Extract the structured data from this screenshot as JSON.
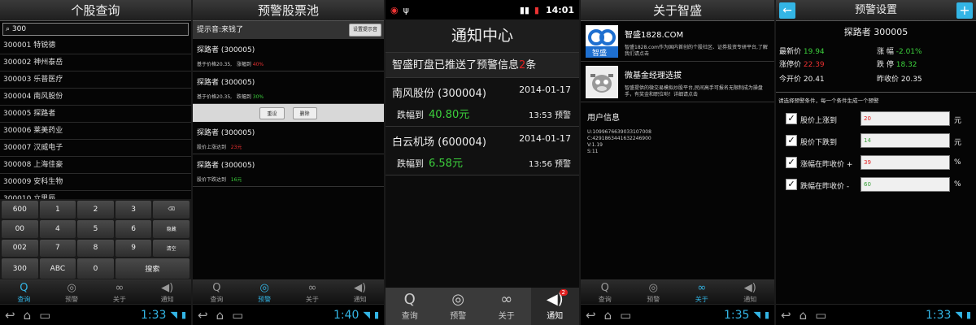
{
  "screen1": {
    "title": "个股查询",
    "search_value": "300",
    "stocks": [
      "300001 特锐德",
      "300002 神州泰岳",
      "300003 乐普医疗",
      "300004 南风股份",
      "300005 探路者",
      "300006 莱美药业",
      "300007 汉威电子",
      "300008 上海佳豪",
      "300009 安科生物",
      "300010 立思辰"
    ],
    "keys": [
      "600",
      "1",
      "2",
      "3",
      "⌫",
      "00",
      "4",
      "5",
      "6",
      "隐藏",
      "002",
      "7",
      "8",
      "9",
      "清空",
      "300",
      "ABC",
      "0",
      "搜索"
    ],
    "tabs": [
      {
        "label": "查询",
        "icon": "Q"
      },
      {
        "label": "预警",
        "icon": "◎"
      },
      {
        "label": "关于",
        "icon": "∞"
      },
      {
        "label": "通知",
        "icon": "◀)"
      }
    ],
    "clock": "1:33"
  },
  "screen2": {
    "title": "预警股票池",
    "hint_label": "提示音:来钱了",
    "set_button": "设置提示音",
    "items": [
      {
        "name": "探路者 (300005)",
        "detail": "基于价格20.35,",
        "change_label": "涨幅到",
        "change_value": "40%",
        "color": "red"
      },
      {
        "name": "探路者 (300005)",
        "detail": "基于价格20.35,",
        "change_label": "跌幅到",
        "change_value": "30%",
        "color": "green"
      }
    ],
    "reset_button": "重设",
    "delete_button": "删除",
    "items2": [
      {
        "name": "探路者 (300005)",
        "detail": "股价上涨达到",
        "value": "23元",
        "color": "red"
      },
      {
        "name": "探路者 (300005)",
        "detail": "股价下跌达到",
        "value": "16元",
        "color": "green"
      }
    ],
    "tabs": [
      {
        "label": "查询",
        "icon": "Q"
      },
      {
        "label": "预警",
        "icon": "◎"
      },
      {
        "label": "关于",
        "icon": "∞"
      },
      {
        "label": "通知",
        "icon": "◀)"
      }
    ],
    "clock": "1:40"
  },
  "screen3": {
    "status_time": "14:01",
    "title": "通知中心",
    "subtitle_pre": "智盛盯盘已推送了预警信息",
    "subtitle_num": "2",
    "subtitle_post": "条",
    "notices": [
      {
        "name": "南风股份 (300004)",
        "date": "2014-01-17",
        "label": "跌幅到",
        "value": "40.80元",
        "time": "13:53 预警"
      },
      {
        "name": "白云机场 (600004)",
        "date": "2014-01-17",
        "label": "跌幅到",
        "value": "6.58元",
        "time": "13:56 预警"
      }
    ],
    "tabs": [
      {
        "label": "查询",
        "icon": "Q"
      },
      {
        "label": "预警",
        "icon": "◎"
      },
      {
        "label": "关于",
        "icon": "∞"
      },
      {
        "label": "通知",
        "icon": "◀)"
      }
    ],
    "badge": "2"
  },
  "screen4": {
    "title": "关于智盛",
    "items": [
      {
        "title": "智盛1828.COM",
        "desc": "智盛1828.com作为国内首创的个股社区、证券投资专研平台,了解我们请点击",
        "logo_text": "智盛"
      },
      {
        "title": "微基金经理选拔",
        "desc": "智盛提供的微交易模拟炒股平台,民间高手可报名无限制成为操盘手，有奖金和职位哟！详细请点击",
        "logo_text": ""
      }
    ],
    "user_info_title": "用户信息",
    "user_info_lines": [
      "U:1099676639033107008",
      "C:4291863441632246900",
      "V:1.19",
      "S:11"
    ],
    "tabs": [
      {
        "label": "查询",
        "icon": "Q"
      },
      {
        "label": "预警",
        "icon": "◎"
      },
      {
        "label": "关于",
        "icon": "∞"
      },
      {
        "label": "通知",
        "icon": "◀)"
      }
    ],
    "clock": "1:35"
  },
  "screen5": {
    "title": "预警设置",
    "back_icon": "←",
    "add_icon": "+",
    "stock_name": "探路者 300005",
    "fields": {
      "latest_label": "最新价",
      "latest_value": "19.94",
      "change_label": "涨 幅",
      "change_value": "-2.01%",
      "limitup_label": "涨停价",
      "limitup_value": "22.39",
      "limitdown_label": "跌 停",
      "limitdown_value": "18.32",
      "open_label": "今开价",
      "open_value": "20.41",
      "prevclose_label": "昨收价",
      "prevclose_value": "20.35"
    },
    "condition_hint": "请选择预警条件，每一个条件生成一个预警",
    "conditions": [
      {
        "label": "股价上涨到",
        "value": "20",
        "unit": "元",
        "color": "#e02020"
      },
      {
        "label": "股价下跌到",
        "value": "14",
        "unit": "元",
        "color": "#3aa03a"
      },
      {
        "label": "涨幅在昨收价 +",
        "value": "39",
        "unit": "%",
        "color": "#e02020"
      },
      {
        "label": "跌幅在昨收价 -",
        "value": "60",
        "unit": "%",
        "color": "#3aa03a"
      }
    ],
    "clock": "1:33"
  },
  "colors": {
    "accent": "#33b5e5",
    "up": "#e83030",
    "down": "#3cd03c"
  }
}
